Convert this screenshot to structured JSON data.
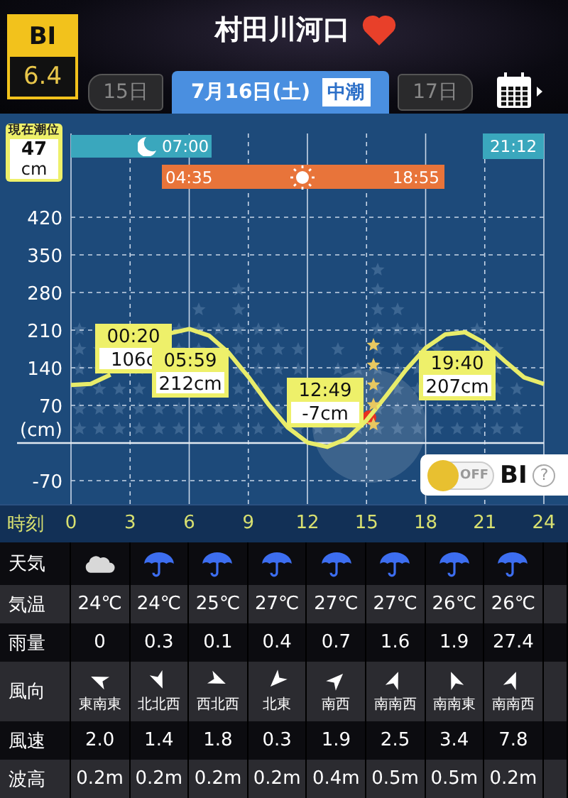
{
  "header": {
    "bi_label": "BI",
    "bi_value": "6.4",
    "title": "村田川河口",
    "favorite": true
  },
  "date_nav": {
    "prev": "15日",
    "current": "7月16日(土)",
    "tide_type": "中潮",
    "next": "17日"
  },
  "current_tide": {
    "label": "現在潮位",
    "value": "47",
    "unit": "cm"
  },
  "moon": {
    "set": "07:00",
    "rise": "21:12"
  },
  "sun": {
    "rise": "04:35",
    "set": "18:55"
  },
  "chart_data": {
    "type": "line",
    "x": [
      0,
      1,
      2,
      3,
      4,
      5,
      6,
      7,
      8,
      9,
      10,
      11,
      12,
      13,
      14,
      15,
      16,
      17,
      18,
      19,
      20,
      21,
      22,
      23,
      24
    ],
    "series": [
      {
        "color": "#e8ec6a",
        "values": [
          108,
          110,
          127,
          null,
          null,
          204,
          212,
          200,
          168,
          123,
          73,
          29,
          1,
          -7,
          8,
          42,
          88,
          136,
          177,
          202,
          206,
          186,
          153,
          122,
          110
        ]
      }
    ],
    "grid": true,
    "xlim": [
      0,
      24
    ],
    "ylim": [
      -113.5,
      575.7
    ],
    "xticks": [
      0,
      3,
      6,
      9,
      12,
      15,
      18,
      21,
      24
    ],
    "yticks": [
      -70,
      70,
      140,
      210,
      280,
      350,
      420
    ],
    "ylabel": "(cm)"
  },
  "tide_events": [
    {
      "time": "00:20",
      "height": "106c"
    },
    {
      "time": "05:59",
      "height": "212cm"
    },
    {
      "time": "12:49",
      "height": "-7cm"
    },
    {
      "time": "19:40",
      "height": "207cm"
    }
  ],
  "bi_toggle": {
    "on": false,
    "state_label": "OFF",
    "label": "BI",
    "help": "?"
  },
  "time_row": {
    "label": "時刻"
  },
  "table": [
    {
      "kind": "weather",
      "label": "天気",
      "cells": [
        {
          "kind": "cloud"
        },
        {
          "kind": "rain"
        },
        {
          "kind": "rain"
        },
        {
          "kind": "rain"
        },
        {
          "kind": "rain"
        },
        {
          "kind": "rain"
        },
        {
          "kind": "rain"
        },
        {
          "kind": "rain"
        }
      ]
    },
    {
      "kind": "text",
      "label": "気温",
      "cells": [
        "24℃",
        "24℃",
        "25℃",
        "27℃",
        "27℃",
        "27℃",
        "26℃",
        "26℃"
      ]
    },
    {
      "kind": "text",
      "label": "雨量",
      "cells": [
        "0",
        "0.3",
        "0.1",
        "0.4",
        "0.7",
        "1.6",
        "1.9",
        "27.4"
      ]
    },
    {
      "kind": "wind",
      "label": "風向",
      "cells": [
        {
          "kind": "ese",
          "text": "東南東"
        },
        {
          "kind": "nnw",
          "text": "北北西"
        },
        {
          "kind": "wnw",
          "text": "西北西"
        },
        {
          "kind": "ne",
          "text": "北東"
        },
        {
          "kind": "sw",
          "text": "南西"
        },
        {
          "kind": "ssw",
          "text": "南南西"
        },
        {
          "kind": "sse",
          "text": "南南東"
        },
        {
          "kind": "ssw",
          "text": "南南西"
        }
      ]
    },
    {
      "kind": "text",
      "label": "風速",
      "cells": [
        "2.0",
        "1.4",
        "1.8",
        "0.3",
        "1.9",
        "2.5",
        "3.4",
        "7.8"
      ]
    },
    {
      "kind": "text",
      "label": "波高",
      "cells": [
        "0.2m",
        "0.2m",
        "0.2m",
        "0.2m",
        "0.4m",
        "0.5m",
        "0.5m",
        "0.2m"
      ]
    }
  ]
}
